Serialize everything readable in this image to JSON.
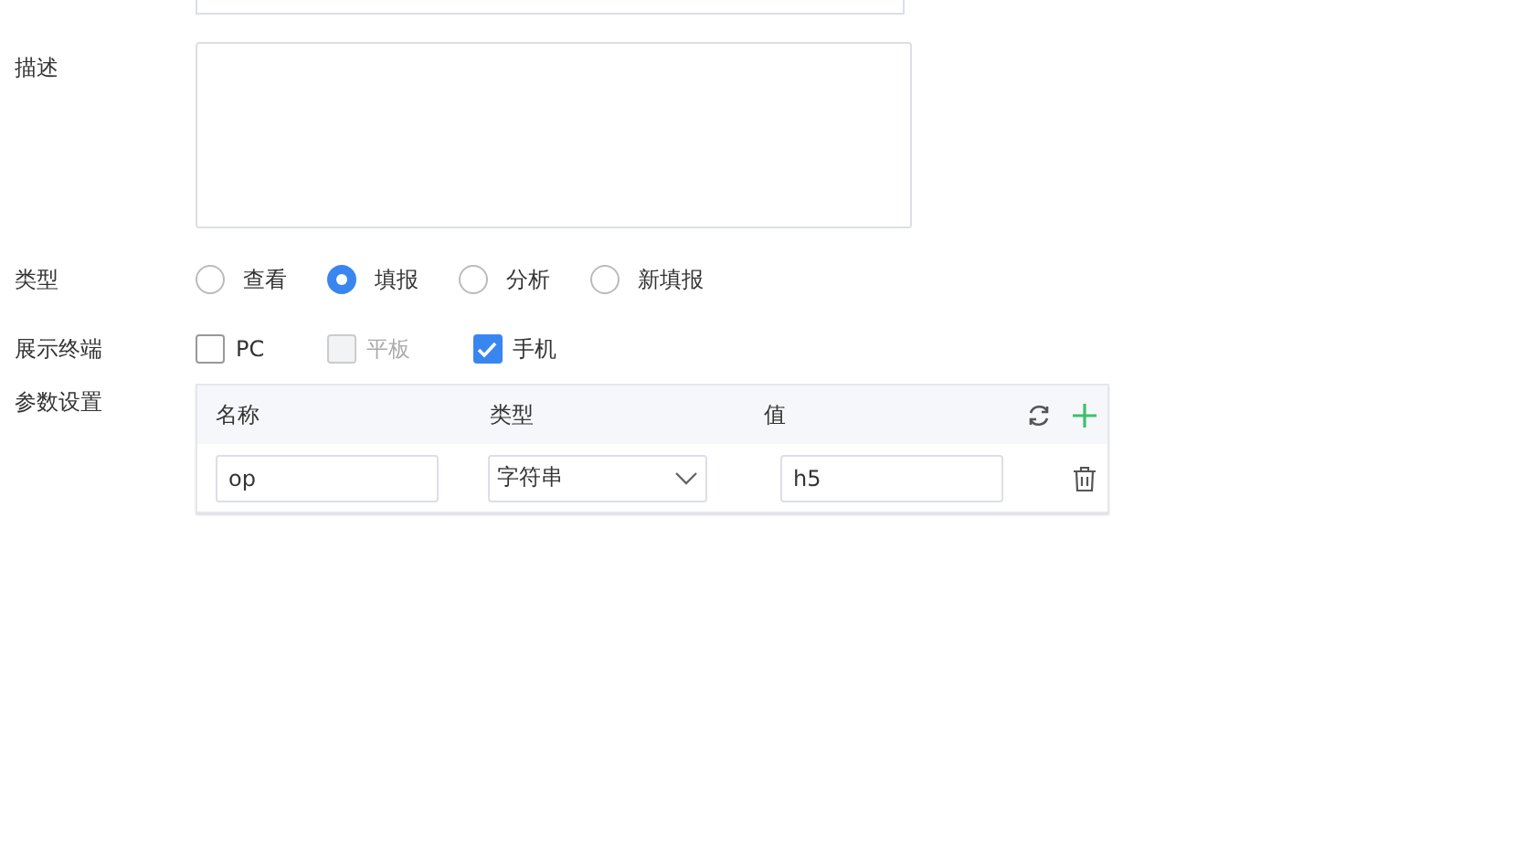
{
  "description": {
    "label": "描述"
  },
  "type": {
    "label": "类型",
    "options": [
      {
        "label": "查看",
        "selected": false
      },
      {
        "label": "填报",
        "selected": true
      },
      {
        "label": "分析",
        "selected": false
      },
      {
        "label": "新填报",
        "selected": false
      }
    ]
  },
  "terminals": {
    "label": "展示终端",
    "options": [
      {
        "label": "PC",
        "checked": false,
        "disabled": false
      },
      {
        "label": "平板",
        "checked": false,
        "disabled": true
      },
      {
        "label": "手机",
        "checked": true,
        "disabled": false
      }
    ]
  },
  "params": {
    "label": "参数设置",
    "columns": [
      "名称",
      "类型",
      "值"
    ],
    "rows": [
      {
        "name": "op",
        "type": "字符串",
        "value": "h5"
      }
    ]
  }
}
